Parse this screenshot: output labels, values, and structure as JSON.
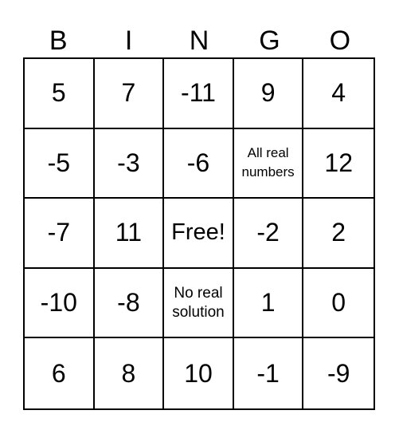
{
  "header": [
    "B",
    "I",
    "N",
    "G",
    "O"
  ],
  "rows": [
    [
      "5",
      "7",
      "-11",
      "9",
      "4"
    ],
    [
      "-5",
      "-3",
      "-6",
      "All real numbers",
      "12"
    ],
    [
      "-7",
      "11",
      "Free!",
      "-2",
      "2"
    ],
    [
      "-10",
      "-8",
      "No real solution",
      "1",
      "0"
    ],
    [
      "6",
      "8",
      "10",
      "-1",
      "-9"
    ]
  ]
}
